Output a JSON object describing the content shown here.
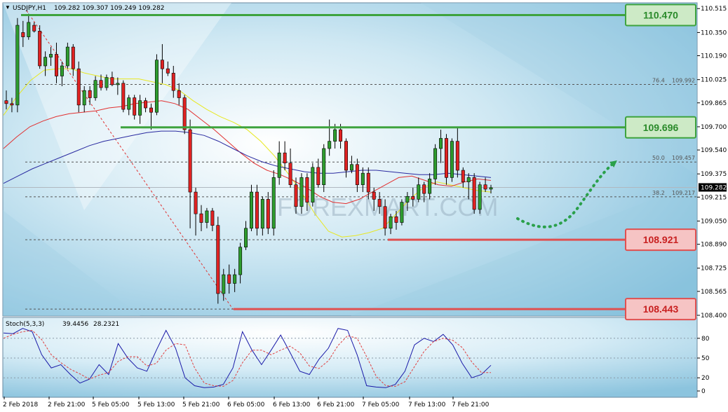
{
  "chart_data": [
    {
      "type": "candlestick",
      "header": {
        "symbol": "USDJPY,H1",
        "ohlc": "109.282 109.307 109.249 109.282"
      },
      "ylim": [
        108.4,
        110.55
      ],
      "y_ticks": [
        "110.515",
        "110.350",
        "110.190",
        "110.025",
        "109.865",
        "109.700",
        "109.540",
        "109.375",
        "109.215",
        "109.050",
        "108.890",
        "108.725",
        "108.565",
        "108.400"
      ],
      "current_price": "109.282",
      "x_labels": [
        "2 Feb 2018",
        "2 Feb 21:00",
        "5 Feb 05:00",
        "5 Feb 13:00",
        "5 Feb 21:00",
        "6 Feb 05:00",
        "6 Feb 13:00",
        "6 Feb 21:00",
        "7 Feb 05:00",
        "7 Feb 13:00",
        "7 Feb 21:00"
      ],
      "levels": [
        {
          "label": "110.470",
          "value": 110.47,
          "kind": "resistance",
          "color": "#3ea33e",
          "box_fill": "#cdeac6"
        },
        {
          "label": "109.696",
          "value": 109.696,
          "kind": "resistance",
          "color": "#3ea33e",
          "box_fill": "#cdeac6"
        },
        {
          "label": "108.921",
          "value": 108.921,
          "kind": "support",
          "color": "#e05050",
          "box_fill": "#f6c4c4"
        },
        {
          "label": "108.443",
          "value": 108.443,
          "kind": "support",
          "color": "#e05050",
          "box_fill": "#f6c4c4"
        }
      ],
      "fibonacci": [
        {
          "ratio": "76.4",
          "value": "109.992",
          "y": 109.992
        },
        {
          "ratio": "50.0",
          "value": "109.457",
          "y": 109.457
        },
        {
          "ratio": "38.2",
          "value": "109.217",
          "y": 109.217
        }
      ],
      "watermark": "FOREXMART.COM",
      "candle_style": {
        "bull_color": "#2e9c2e",
        "bear_color": "#e02222"
      },
      "candles": [
        [
          109.88,
          109.95,
          109.82,
          109.86
        ],
        [
          109.86,
          109.9,
          109.8,
          109.85
        ],
        [
          109.85,
          110.45,
          109.8,
          110.4
        ],
        [
          110.35,
          110.43,
          110.25,
          110.32
        ],
        [
          110.32,
          110.48,
          110.3,
          110.42
        ],
        [
          110.4,
          110.42,
          110.35,
          110.36
        ],
        [
          110.36,
          110.4,
          110.1,
          110.12
        ],
        [
          110.12,
          110.22,
          110.05,
          110.18
        ],
        [
          110.18,
          110.25,
          110.12,
          110.2
        ],
        [
          110.2,
          110.28,
          110.0,
          110.05
        ],
        [
          110.05,
          110.15,
          109.98,
          110.12
        ],
        [
          110.12,
          110.28,
          110.1,
          110.25
        ],
        [
          110.25,
          110.27,
          110.05,
          110.1
        ],
        [
          110.1,
          110.15,
          109.8,
          109.85
        ],
        [
          109.85,
          109.98,
          109.8,
          109.95
        ],
        [
          109.95,
          109.98,
          109.85,
          109.9
        ],
        [
          109.9,
          110.05,
          109.88,
          110.02
        ],
        [
          110.02,
          110.06,
          109.95,
          109.97
        ],
        [
          109.97,
          110.06,
          109.95,
          110.04
        ],
        [
          110.04,
          110.08,
          109.98,
          109.99
        ],
        [
          109.99,
          110.04,
          109.92,
          110.0
        ],
        [
          110.0,
          110.02,
          109.8,
          109.82
        ],
        [
          109.82,
          109.92,
          109.78,
          109.9
        ],
        [
          109.9,
          109.92,
          109.75,
          109.78
        ],
        [
          109.78,
          109.92,
          109.72,
          109.88
        ],
        [
          109.88,
          109.9,
          109.8,
          109.83
        ],
        [
          109.83,
          109.86,
          109.68,
          109.8
        ],
        [
          109.8,
          110.2,
          109.78,
          110.16
        ],
        [
          110.16,
          110.27,
          110.0,
          110.1
        ],
        [
          110.1,
          110.15,
          110.05,
          110.07
        ],
        [
          110.07,
          110.12,
          109.9,
          109.95
        ],
        [
          109.95,
          110.0,
          109.85,
          109.9
        ],
        [
          109.9,
          109.92,
          109.65,
          109.68
        ],
        [
          109.68,
          109.75,
          109.0,
          109.25
        ],
        [
          109.25,
          109.28,
          108.95,
          109.1
        ],
        [
          109.1,
          109.16,
          108.98,
          109.04
        ],
        [
          109.04,
          109.14,
          109.0,
          109.12
        ],
        [
          109.12,
          109.14,
          108.98,
          109.02
        ],
        [
          109.02,
          109.08,
          108.48,
          108.55
        ],
        [
          108.55,
          108.72,
          108.5,
          108.68
        ],
        [
          108.68,
          108.75,
          108.55,
          108.62
        ],
        [
          108.62,
          108.72,
          108.56,
          108.68
        ],
        [
          108.68,
          108.9,
          108.62,
          108.87
        ],
        [
          108.87,
          109.05,
          108.85,
          109.0
        ],
        [
          109.0,
          109.3,
          108.98,
          109.25
        ],
        [
          109.25,
          109.3,
          108.95,
          109.0
        ],
        [
          109.0,
          109.22,
          108.95,
          109.2
        ],
        [
          109.2,
          109.25,
          108.96,
          109.0
        ],
        [
          109.0,
          109.4,
          108.95,
          109.35
        ],
        [
          109.35,
          109.6,
          109.3,
          109.52
        ],
        [
          109.52,
          109.6,
          109.4,
          109.45
        ],
        [
          109.45,
          109.55,
          109.28,
          109.3
        ],
        [
          109.3,
          109.35,
          109.1,
          109.15
        ],
        [
          109.15,
          109.38,
          109.1,
          109.35
        ],
        [
          109.35,
          109.38,
          109.12,
          109.18
        ],
        [
          109.18,
          109.45,
          109.15,
          109.42
        ],
        [
          109.42,
          109.48,
          109.28,
          109.3
        ],
        [
          109.3,
          109.58,
          109.25,
          109.55
        ],
        [
          109.55,
          109.75,
          109.5,
          109.6
        ],
        [
          109.6,
          109.72,
          109.55,
          109.68
        ],
        [
          109.68,
          109.72,
          109.55,
          109.6
        ],
        [
          109.6,
          109.62,
          109.35,
          109.4
        ],
        [
          109.4,
          109.5,
          109.38,
          109.44
        ],
        [
          109.44,
          109.48,
          109.25,
          109.3
        ],
        [
          109.3,
          109.42,
          109.25,
          109.38
        ],
        [
          109.38,
          109.42,
          109.2,
          109.25
        ],
        [
          109.25,
          109.28,
          109.12,
          109.2
        ],
        [
          109.2,
          109.25,
          109.1,
          109.15
        ],
        [
          109.15,
          109.2,
          108.95,
          109.0
        ],
        [
          109.0,
          109.1,
          108.96,
          109.08
        ],
        [
          109.08,
          109.12,
          108.99,
          109.04
        ],
        [
          109.04,
          109.2,
          109.02,
          109.18
        ],
        [
          109.18,
          109.25,
          109.12,
          109.22
        ],
        [
          109.22,
          109.28,
          109.15,
          109.2
        ],
        [
          109.2,
          109.35,
          109.18,
          109.3
        ],
        [
          109.3,
          109.32,
          109.18,
          109.24
        ],
        [
          109.24,
          109.38,
          109.2,
          109.34
        ],
        [
          109.34,
          109.58,
          109.3,
          109.55
        ],
        [
          109.55,
          109.68,
          109.45,
          109.62
        ],
        [
          109.62,
          109.65,
          109.3,
          109.35
        ],
        [
          109.35,
          109.62,
          109.32,
          109.6
        ],
        [
          109.6,
          109.7,
          109.35,
          109.4
        ],
        [
          109.4,
          109.42,
          109.28,
          109.32
        ],
        [
          109.32,
          109.38,
          109.2,
          109.35
        ],
        [
          109.35,
          109.38,
          109.1,
          109.13
        ],
        [
          109.13,
          109.32,
          109.1,
          109.3
        ],
        [
          109.3,
          109.35,
          109.25,
          109.27
        ],
        [
          109.27,
          109.3,
          109.24,
          109.28
        ]
      ],
      "ma_series": [
        {
          "color": "#e8e820",
          "values": [
            109.78,
            109.91,
            110.02,
            110.09,
            110.1,
            110.1,
            110.07,
            110.05,
            110.03,
            110.03,
            110.03,
            110.01,
            109.99,
            109.95,
            109.88,
            109.82,
            109.77,
            109.73,
            109.68,
            109.6,
            109.5,
            109.38,
            109.25,
            109.1,
            108.98,
            108.94,
            108.95,
            108.97,
            109.0,
            109.1,
            109.2,
            109.28,
            109.32,
            109.3,
            109.28,
            109.26,
            109.25
          ]
        },
        {
          "color": "#e23030",
          "values": [
            109.55,
            109.63,
            109.7,
            109.74,
            109.77,
            109.79,
            109.8,
            109.81,
            109.83,
            109.84,
            109.86,
            109.87,
            109.88,
            109.86,
            109.82,
            109.75,
            109.68,
            109.6,
            109.52,
            109.45,
            109.4,
            109.37,
            109.33,
            109.28,
            109.22,
            109.18,
            109.17,
            109.2,
            109.25,
            109.3,
            109.35,
            109.36,
            109.33,
            109.3,
            109.29,
            109.32,
            109.34,
            109.33
          ]
        },
        {
          "color": "#2a2aa0",
          "values": [
            109.31,
            109.36,
            109.41,
            109.45,
            109.49,
            109.53,
            109.57,
            109.6,
            109.62,
            109.64,
            109.66,
            109.67,
            109.67,
            109.66,
            109.64,
            109.6,
            109.55,
            109.5,
            109.46,
            109.43,
            109.41,
            109.39,
            109.38,
            109.38,
            109.39,
            109.4,
            109.4,
            109.39,
            109.38,
            109.37,
            109.37,
            109.38,
            109.37,
            109.36,
            109.35
          ]
        }
      ],
      "forecast": {
        "color": "#2aa04a"
      }
    },
    {
      "type": "line",
      "header": {
        "indicator": "Stoch(5,3,3)",
        "k_value": "39.4456",
        "d_value": "28.2321"
      },
      "ylim": [
        0,
        100
      ],
      "y_ticks": [
        "80",
        "50",
        "20",
        "0"
      ],
      "levels": [
        80,
        50,
        20
      ],
      "series": [
        {
          "color": "#1a1aa8",
          "dash": false,
          "values": [
            88,
            87,
            95,
            90,
            55,
            35,
            40,
            25,
            12,
            18,
            40,
            25,
            72,
            50,
            35,
            30,
            62,
            92,
            65,
            20,
            8,
            5,
            6,
            10,
            35,
            90,
            62,
            40,
            62,
            85,
            58,
            30,
            25,
            48,
            65,
            95,
            92,
            55,
            8,
            6,
            5,
            10,
            30,
            70,
            80,
            75,
            86,
            70,
            42,
            20,
            25,
            39
          ]
        },
        {
          "color": "#e04040",
          "dash": true,
          "values": [
            80,
            86,
            90,
            92,
            78,
            55,
            43,
            33,
            26,
            18,
            24,
            28,
            45,
            52,
            52,
            38,
            42,
            62,
            72,
            70,
            35,
            12,
            8,
            7,
            16,
            43,
            62,
            62,
            55,
            62,
            68,
            58,
            38,
            34,
            46,
            69,
            84,
            80,
            52,
            22,
            8,
            7,
            14,
            37,
            60,
            75,
            80,
            77,
            66,
            44,
            28,
            28
          ]
        }
      ]
    }
  ]
}
